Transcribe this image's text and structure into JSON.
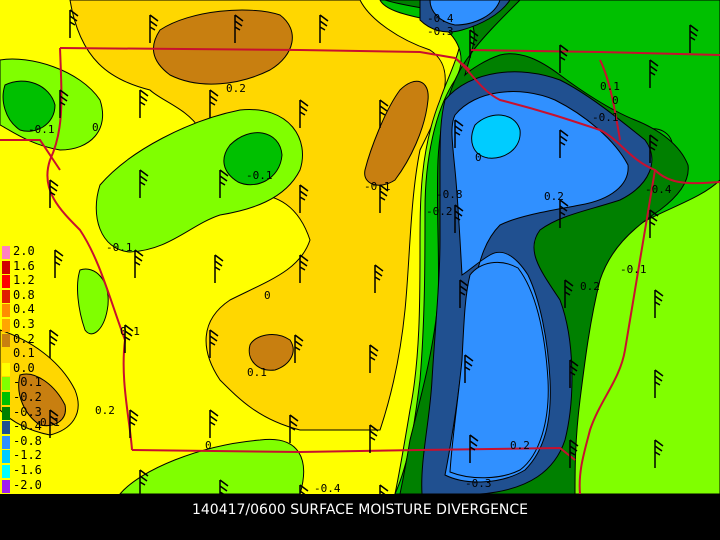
{
  "title": "140417/0600 SURFACE MOISTURE DIVERGENCE",
  "legend": {
    "items": [
      {
        "label": "2.0",
        "color": "#ff80c0"
      },
      {
        "label": "1.6",
        "color": "#d00000"
      },
      {
        "label": "1.2",
        "color": "#ff0000"
      },
      {
        "label": "0.8",
        "color": "#e02000"
      },
      {
        "label": "0.4",
        "color": "#ff8c00"
      },
      {
        "label": "0.3",
        "color": "#ffa500"
      },
      {
        "label": "0.2",
        "color": "#c87f10"
      },
      {
        "label": "0.1",
        "color": "#ffd700"
      },
      {
        "label": "0.0",
        "color": "#ffff00"
      },
      {
        "label": "-0.1",
        "color": "#80ff00"
      },
      {
        "label": "-0.2",
        "color": "#00c000"
      },
      {
        "label": "-0.3",
        "color": "#008000"
      },
      {
        "label": "-0.4",
        "color": "#205090"
      },
      {
        "label": "-0.8",
        "color": "#3090ff"
      },
      {
        "label": "-1.2",
        "color": "#00ccff"
      },
      {
        "label": "-1.6",
        "color": "#00ffff"
      },
      {
        "label": "-2.0",
        "color": "#a020f0"
      }
    ]
  },
  "contour_labels": [
    "-0.4",
    "-0.3",
    "0.2",
    "0",
    "-0.1",
    "0",
    "0.1",
    "-0.1",
    "0",
    "-0.1",
    "-0.8",
    "-0.2",
    "-0.1",
    "0.2",
    "-0.4",
    "-0.1",
    "0.2",
    "0",
    "-0.1",
    "0.1",
    "0.2",
    "0.1",
    "0",
    "0.2",
    "-0.3",
    "-0.4",
    "0.1",
    "0.1"
  ],
  "colors": {
    "state_border": "#c8102e",
    "contour": "#000000",
    "background": "#000000"
  },
  "icons": [
    "wind-barb-icon"
  ]
}
